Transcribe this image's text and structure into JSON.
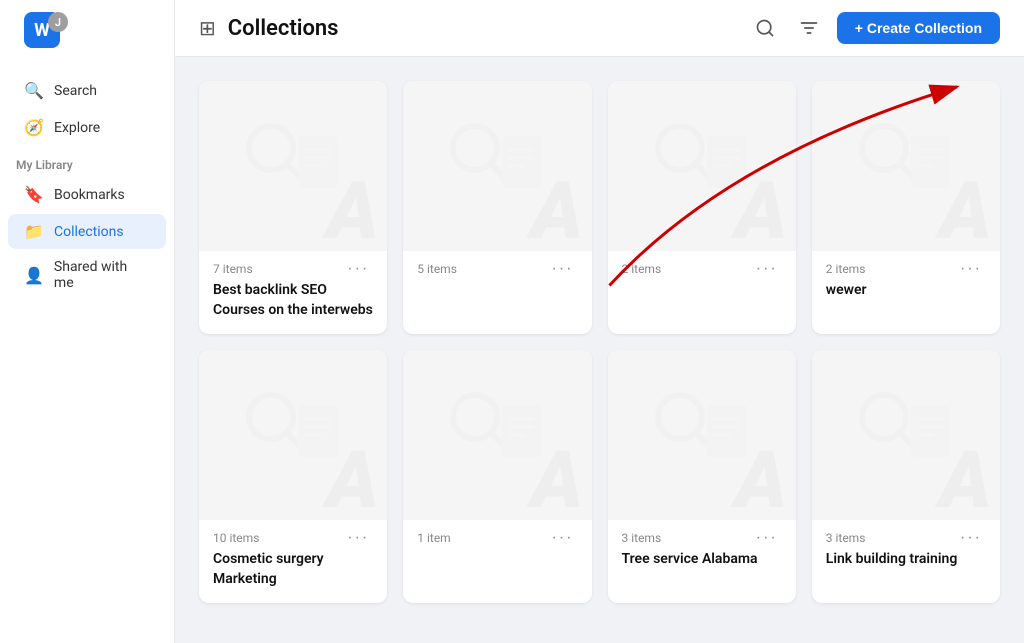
{
  "app": {
    "logo_letter": "W",
    "user_initial": "J"
  },
  "sidebar": {
    "nav_items": [
      {
        "id": "search",
        "label": "Search",
        "icon": "🔍",
        "active": false
      },
      {
        "id": "explore",
        "label": "Explore",
        "icon": "🧭",
        "active": false
      }
    ],
    "my_library_title": "My Library",
    "library_items": [
      {
        "id": "bookmarks",
        "label": "Bookmarks",
        "icon": "🔖",
        "active": false
      },
      {
        "id": "collections",
        "label": "Collections",
        "icon": "📁",
        "active": true
      },
      {
        "id": "shared",
        "label": "Shared with me",
        "icon": "👤",
        "active": false
      }
    ]
  },
  "header": {
    "panel_icon": "▦",
    "title": "Collections",
    "search_tooltip": "Search",
    "sort_tooltip": "Sort",
    "create_label": "+ Create Collection"
  },
  "collections": [
    {
      "id": 1,
      "count": "7 items",
      "title": "Best backlink SEO Courses on the interwebs"
    },
    {
      "id": 2,
      "count": "5 items",
      "title": ""
    },
    {
      "id": 3,
      "count": "2 items",
      "title": ""
    },
    {
      "id": 4,
      "count": "2 items",
      "title": "wewer"
    },
    {
      "id": 5,
      "count": "10 items",
      "title": "Cosmetic surgery Marketing"
    },
    {
      "id": 6,
      "count": "1 item",
      "title": ""
    },
    {
      "id": 7,
      "count": "3 items",
      "title": "Tree service Alabama"
    },
    {
      "id": 8,
      "count": "3 items",
      "title": "Link building training"
    }
  ],
  "arrow": {
    "color": "#cc0000"
  }
}
